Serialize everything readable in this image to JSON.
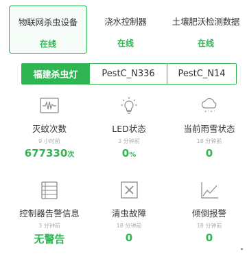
{
  "device_tabs": [
    {
      "name": "物联网杀虫设备",
      "status": "在线"
    },
    {
      "name": "浇水控制器",
      "status": "在线"
    },
    {
      "name": "土壤肥沃检测数据",
      "status": "在线"
    }
  ],
  "sub_tabs": [
    "福建杀虫灯",
    "PestC_N336",
    "PestC_N14"
  ],
  "metrics": [
    {
      "label": "灭蚊次数",
      "time": "9 小时前",
      "value": "677330",
      "unit": "次",
      "icon": "waveform-monitor-icon"
    },
    {
      "label": "LED状态",
      "time": "3 分钟前",
      "value": "0",
      "unit": "%",
      "icon": "lightbulb-icon"
    },
    {
      "label": "当前雨雪状态",
      "time": "18 分钟前",
      "value": "0",
      "unit": "",
      "icon": "rain-snow-cloud-icon"
    },
    {
      "label": "控制器告警信息",
      "time": "3 分钟前",
      "value": "无警告",
      "unit": "",
      "icon": "list-icon"
    },
    {
      "label": "清虫故障",
      "time": "18 分钟前",
      "value": "0",
      "unit": "",
      "icon": "close-box-icon"
    },
    {
      "label": "倾倒报警",
      "time": "18 分钟前",
      "value": "0",
      "unit": "",
      "icon": "line-chart-icon"
    }
  ],
  "colors": {
    "accent": "#2fb653",
    "icon": "#8a8a8a"
  }
}
